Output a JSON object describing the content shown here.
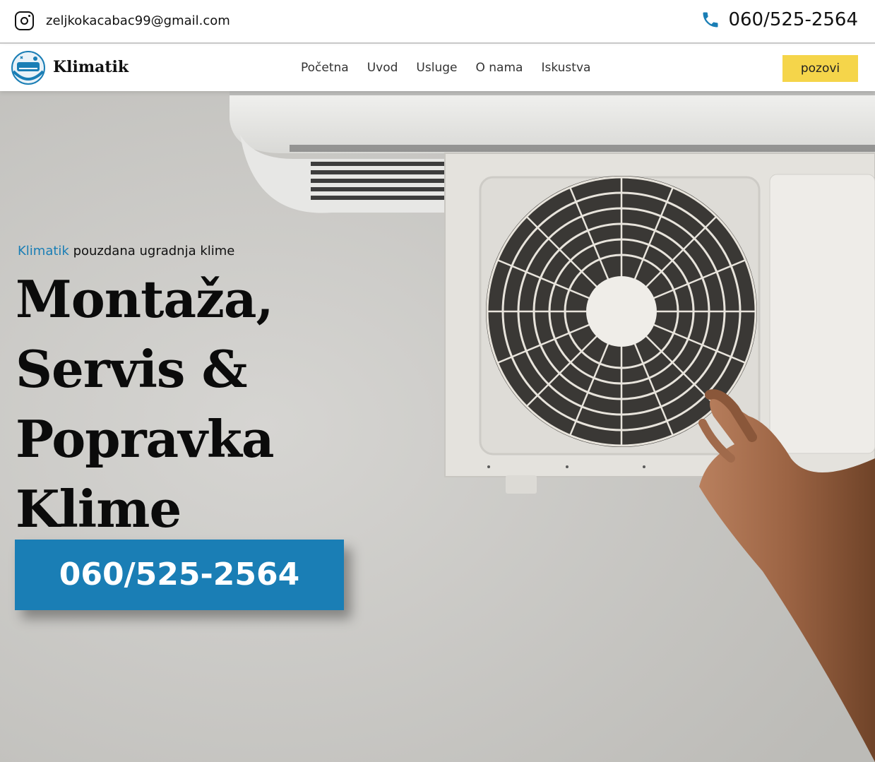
{
  "topbar": {
    "email": "zeljkokacabac99@gmail.com",
    "phone": "060/525-2564"
  },
  "nav": {
    "brand": "Klimatik",
    "items": [
      {
        "label": "Početna"
      },
      {
        "label": "Uvod"
      },
      {
        "label": "Usluge"
      },
      {
        "label": "O nama"
      },
      {
        "label": "Iskustva"
      }
    ],
    "cta_label": "pozovi"
  },
  "hero": {
    "tagline_brand": "Klimatik",
    "tagline_rest": " pouzdana ugradnja klime",
    "headline_lines": [
      "Montaža,",
      "Servis &",
      "Popravka",
      "Klime"
    ],
    "cta_phone": "060/525-2564"
  },
  "colors": {
    "accent": "#1a7eb5",
    "button_yellow": "#f5d54a"
  }
}
